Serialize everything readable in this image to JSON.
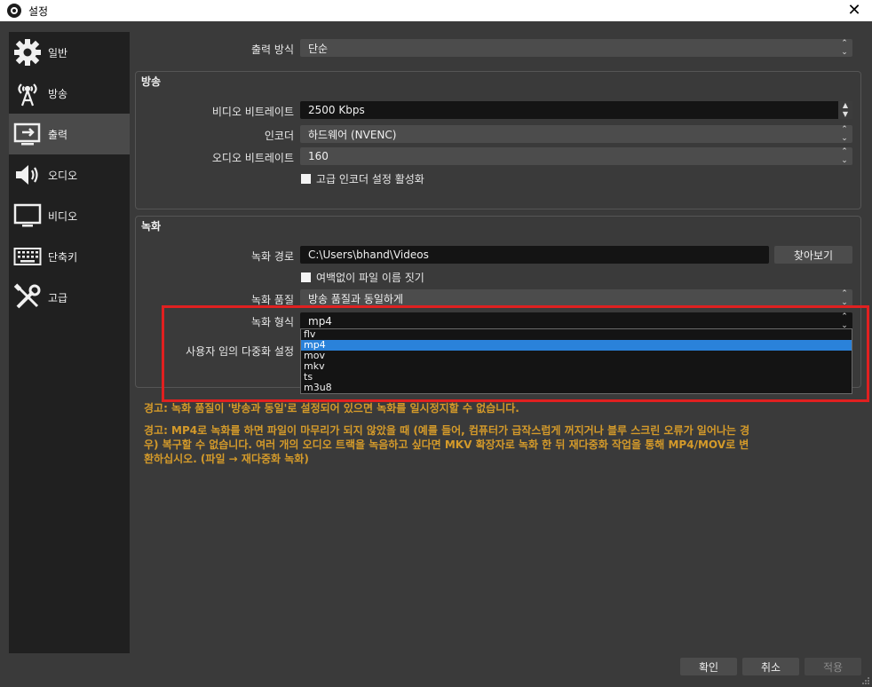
{
  "window": {
    "title": "설정",
    "close_glyph": "✕"
  },
  "sidebar": {
    "items": [
      {
        "label": "일반",
        "icon": "gear-icon"
      },
      {
        "label": "방송",
        "icon": "broadcast-antenna-icon"
      },
      {
        "label": "출력",
        "icon": "output-monitor-icon",
        "active": true
      },
      {
        "label": "오디오",
        "icon": "speaker-icon"
      },
      {
        "label": "비디오",
        "icon": "monitor-icon"
      },
      {
        "label": "단축키",
        "icon": "keyboard-icon"
      },
      {
        "label": "고급",
        "icon": "tools-icon"
      }
    ]
  },
  "output_mode": {
    "label": "출력 방식",
    "value": "단순"
  },
  "streaming": {
    "title": "방송",
    "video_bitrate": {
      "label": "비디오 비트레이트",
      "value": "2500 Kbps"
    },
    "encoder": {
      "label": "인코더",
      "value": "하드웨어 (NVENC)"
    },
    "audio_bitrate": {
      "label": "오디오 비트레이트",
      "value": "160"
    },
    "advanced_encoder": {
      "label": "고급 인코더 설정 활성화"
    }
  },
  "recording": {
    "title": "녹화",
    "path": {
      "label": "녹화 경로",
      "value": "C:\\Users\\bhand\\Videos",
      "browse_label": "찾아보기"
    },
    "no_space": {
      "label": "여백없이 파일 이름 짓기"
    },
    "quality": {
      "label": "녹화 품질",
      "value": "방송 품질과 동일하게"
    },
    "format": {
      "label": "녹화 형식",
      "value": "mp4",
      "options": [
        "flv",
        "mp4",
        "mov",
        "mkv",
        "ts",
        "m3u8"
      ],
      "selected_index": 1
    },
    "muxer": {
      "label": "사용자 임의 다중화 설정"
    }
  },
  "warnings": {
    "quality": "경고: 녹화 품질이 '방송과 동일'로 설정되어 있으면 녹화를 일시정지할 수 없습니다.",
    "mp4_line1": "경고: MP4로 녹화를 하면 파일이 마무리가 되지 않았을 때 (예를 들어, 컴퓨터가 급작스럽게 꺼지거나 블루 스크린 오류가 일어나는 경",
    "mp4_line2": "우) 복구할 수 없습니다. 여러 개의 오디오 트랙을 녹음하고 싶다면 MKV 확장자로 녹화 한 뒤 재다중화 작업을 통해 MP4/MOV로 변",
    "mp4_line3": "환하십시오. (파일 → 재다중화 녹화)"
  },
  "footer": {
    "ok": "확인",
    "cancel": "취소",
    "apply": "적용"
  },
  "colors": {
    "background": "#3a3a3a",
    "sidebar": "#202020",
    "highlight": "#e02020",
    "selection": "#2a82da",
    "warning": "#d49a2a"
  }
}
